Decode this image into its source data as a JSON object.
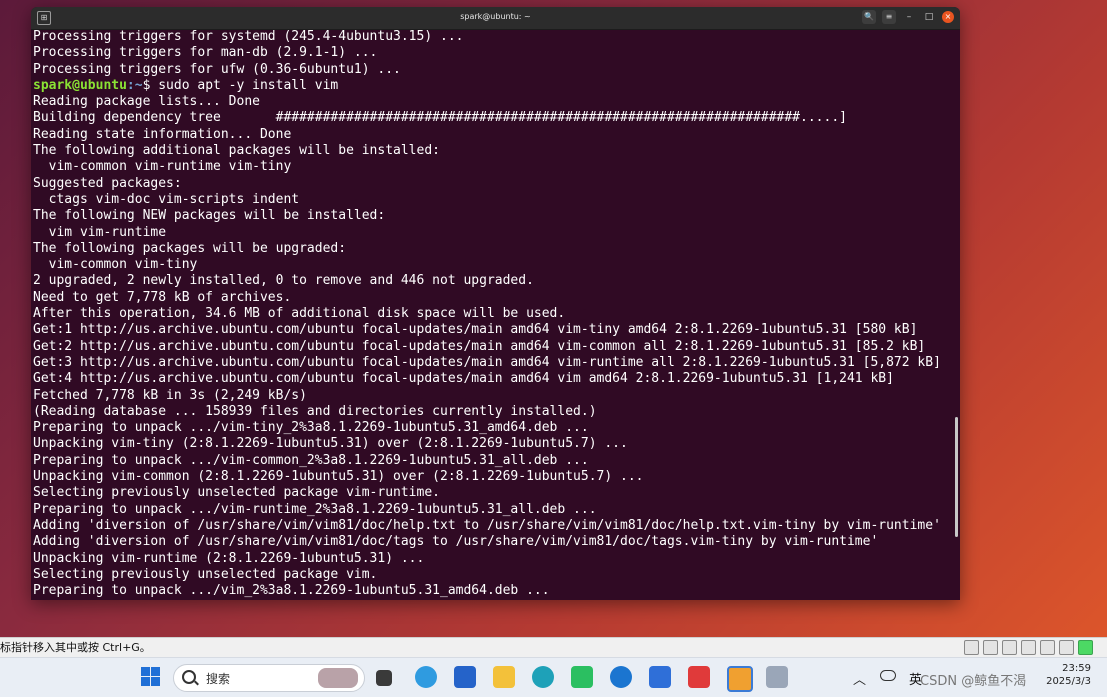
{
  "terminal": {
    "title": "spark@ubuntu: ~",
    "prompt_user": "spark@ubuntu",
    "prompt_path": ":~",
    "prompt_cmd": "$ sudo apt -y install vim",
    "lines": [
      "Processing triggers for systemd (245.4-4ubuntu3.15) ...",
      "Processing triggers for man-db (2.9.1-1) ...",
      "Processing triggers for ufw (0.36-6ubuntu1) ...",
      "__PROMPT__",
      "Reading package lists... Done",
      "Building dependency tree       ###################################################################.....]",
      "Reading state information... Done",
      "The following additional packages will be installed:",
      "  vim-common vim-runtime vim-tiny",
      "Suggested packages:",
      "  ctags vim-doc vim-scripts indent",
      "The following NEW packages will be installed:",
      "  vim vim-runtime",
      "The following packages will be upgraded:",
      "  vim-common vim-tiny",
      "2 upgraded, 2 newly installed, 0 to remove and 446 not upgraded.",
      "Need to get 7,778 kB of archives.",
      "After this operation, 34.6 MB of additional disk space will be used.",
      "Get:1 http://us.archive.ubuntu.com/ubuntu focal-updates/main amd64 vim-tiny amd64 2:8.1.2269-1ubuntu5.31 [580 kB]",
      "Get:2 http://us.archive.ubuntu.com/ubuntu focal-updates/main amd64 vim-common all 2:8.1.2269-1ubuntu5.31 [85.2 kB]",
      "Get:3 http://us.archive.ubuntu.com/ubuntu focal-updates/main amd64 vim-runtime all 2:8.1.2269-1ubuntu5.31 [5,872 kB]",
      "Get:4 http://us.archive.ubuntu.com/ubuntu focal-updates/main amd64 vim amd64 2:8.1.2269-1ubuntu5.31 [1,241 kB]",
      "Fetched 7,778 kB in 3s (2,249 kB/s)",
      "(Reading database ... 158939 files and directories currently installed.)",
      "Preparing to unpack .../vim-tiny_2%3a8.1.2269-1ubuntu5.31_amd64.deb ...",
      "Unpacking vim-tiny (2:8.1.2269-1ubuntu5.31) over (2:8.1.2269-1ubuntu5.7) ...",
      "Preparing to unpack .../vim-common_2%3a8.1.2269-1ubuntu5.31_all.deb ...",
      "Unpacking vim-common (2:8.1.2269-1ubuntu5.31) over (2:8.1.2269-1ubuntu5.7) ...",
      "Selecting previously unselected package vim-runtime.",
      "Preparing to unpack .../vim-runtime_2%3a8.1.2269-1ubuntu5.31_all.deb ...",
      "Adding 'diversion of /usr/share/vim/vim81/doc/help.txt to /usr/share/vim/vim81/doc/help.txt.vim-tiny by vim-runtime'",
      "Adding 'diversion of /usr/share/vim/vim81/doc/tags to /usr/share/vim/vim81/doc/tags.vim-tiny by vim-runtime'",
      "Unpacking vim-runtime (2:8.1.2269-1ubuntu5.31) ...",
      "Selecting previously unselected package vim.",
      "Preparing to unpack .../vim_2%3a8.1.2269-1ubuntu5.31_amd64.deb ..."
    ]
  },
  "vm_status": {
    "text": "标指针移入其中或按 Ctrl+G。"
  },
  "taskbar": {
    "search_placeholder": "搜索",
    "ime": "英",
    "watermark": "CSDN @鲸鱼不渴",
    "time": "23:59",
    "date": "2025/3/3"
  },
  "icons": [
    "terminal-new-tab-icon",
    "search-icon",
    "menu-icon",
    "minimize-icon",
    "maximize-icon",
    "close-icon",
    "windows-start-icon",
    "file-explorer-icon",
    "edge-icon",
    "store-icon",
    "folder-icon",
    "chat-icon",
    "app-icon",
    "wps-icon",
    "vmware-icon",
    "usb-icon",
    "cloud-icon"
  ],
  "colors": {
    "terminal_bg": "#300a24",
    "prompt_user": "#8ae234",
    "prompt_path": "#729fcf",
    "close_button": "#e95420"
  }
}
